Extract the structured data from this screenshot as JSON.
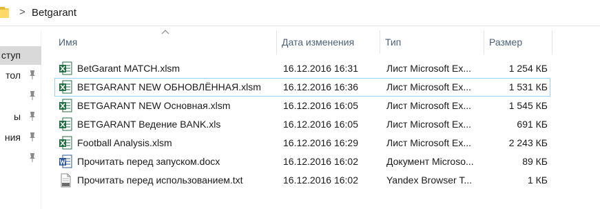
{
  "address_bar": {
    "chevron": ">",
    "crumb": "Betgarant"
  },
  "nav": {
    "items": [
      {
        "label": "ступ",
        "selected": true,
        "pinned": false
      },
      {
        "label": "тол",
        "selected": false,
        "pinned": true
      },
      {
        "label": "",
        "selected": false,
        "pinned": true
      },
      {
        "label": "ы",
        "selected": false,
        "pinned": true
      },
      {
        "label": "ния",
        "selected": false,
        "pinned": true
      },
      {
        "label": "",
        "selected": false,
        "pinned": true
      }
    ]
  },
  "columns": {
    "name": "Имя",
    "date": "Дата изменения",
    "type": "Тип",
    "size": "Размер"
  },
  "files": [
    {
      "name": "BetGarant  MATCH.xlsm",
      "date": "16.12.2016 16:31",
      "type": "Лист Microsoft Ex...",
      "size": "1 254 КБ",
      "icon": "excel-icon"
    },
    {
      "name": "BETGARANT NEW ОБНОВЛЁННАЯ.xlsm",
      "date": "16.12.2016 16:36",
      "type": "Лист Microsoft Ex...",
      "size": "1 531 КБ",
      "icon": "excel-icon",
      "focused": true
    },
    {
      "name": "BETGARANT NEW Основная.xlsm",
      "date": "16.12.2016 16:05",
      "type": "Лист Microsoft Ex...",
      "size": "1 545 КБ",
      "icon": "excel-icon"
    },
    {
      "name": "BETGARANT Ведение BANK.xls",
      "date": "16.12.2016 16:05",
      "type": "Лист Microsoft Ex...",
      "size": "691 КБ",
      "icon": "excel-icon"
    },
    {
      "name": "Football Analysis.xlsm",
      "date": "16.12.2016 16:29",
      "type": "Лист Microsoft Ex...",
      "size": "2 243 КБ",
      "icon": "excel-icon"
    },
    {
      "name": "Прочитать перед запуском.docx",
      "date": "16.12.2016 16:02",
      "type": "Документ Microso...",
      "size": "89 КБ",
      "icon": "word-icon"
    },
    {
      "name": "Прочитать перед использованием.txt",
      "date": "16.12.2016 16:02",
      "type": "Yandex Browser T...",
      "size": "1 КБ",
      "icon": "text-file-icon"
    }
  ],
  "colors": {
    "excel_green": "#1d6f42",
    "word_blue": "#2b579a",
    "header_text": "#4c607a",
    "focus_border": "#99d1ff",
    "selected_nav": "#d9d9d9"
  }
}
